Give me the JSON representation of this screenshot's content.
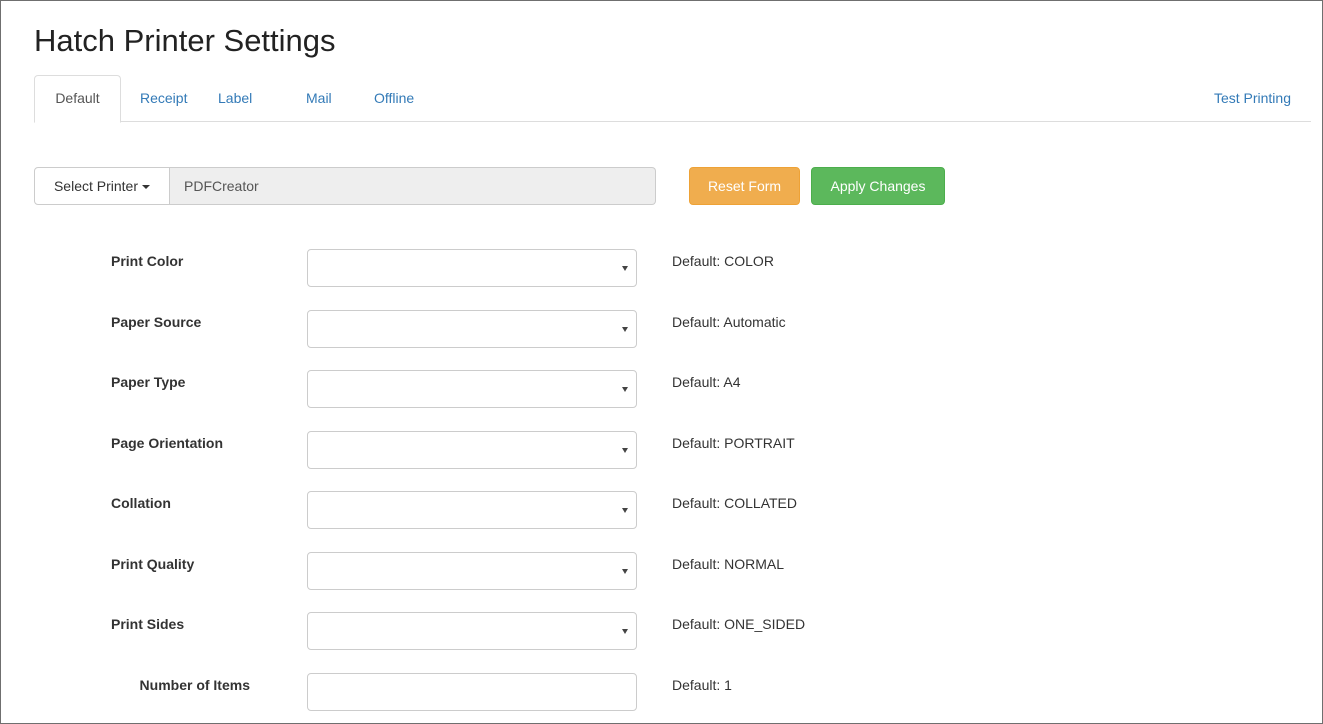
{
  "page": {
    "title": "Hatch Printer Settings"
  },
  "tabs": {
    "default": "Default",
    "receipt": "Receipt",
    "label": "Label",
    "mail": "Mail",
    "offline": "Offline",
    "test_printing": "Test Printing"
  },
  "printer": {
    "select_label": "Select Printer",
    "current": "PDFCreator"
  },
  "actions": {
    "reset": "Reset Form",
    "apply": "Apply Changes"
  },
  "settings": [
    {
      "label": "Print Color",
      "default": "Default: COLOR"
    },
    {
      "label": "Paper Source",
      "default": "Default: Automatic"
    },
    {
      "label": "Paper Type",
      "default": "Default: A4"
    },
    {
      "label": "Page Orientation",
      "default": "Default: PORTRAIT"
    },
    {
      "label": "Collation",
      "default": "Default: COLLATED"
    },
    {
      "label": "Print Quality",
      "default": "Default: NORMAL"
    },
    {
      "label": "Print Sides",
      "default": "Default: ONE_SIDED"
    },
    {
      "label": "Number of Items",
      "default": "Default: 1"
    }
  ],
  "colors": {
    "link": "#337ab7",
    "warning": "#f0ad4e",
    "success": "#5cb85c"
  }
}
